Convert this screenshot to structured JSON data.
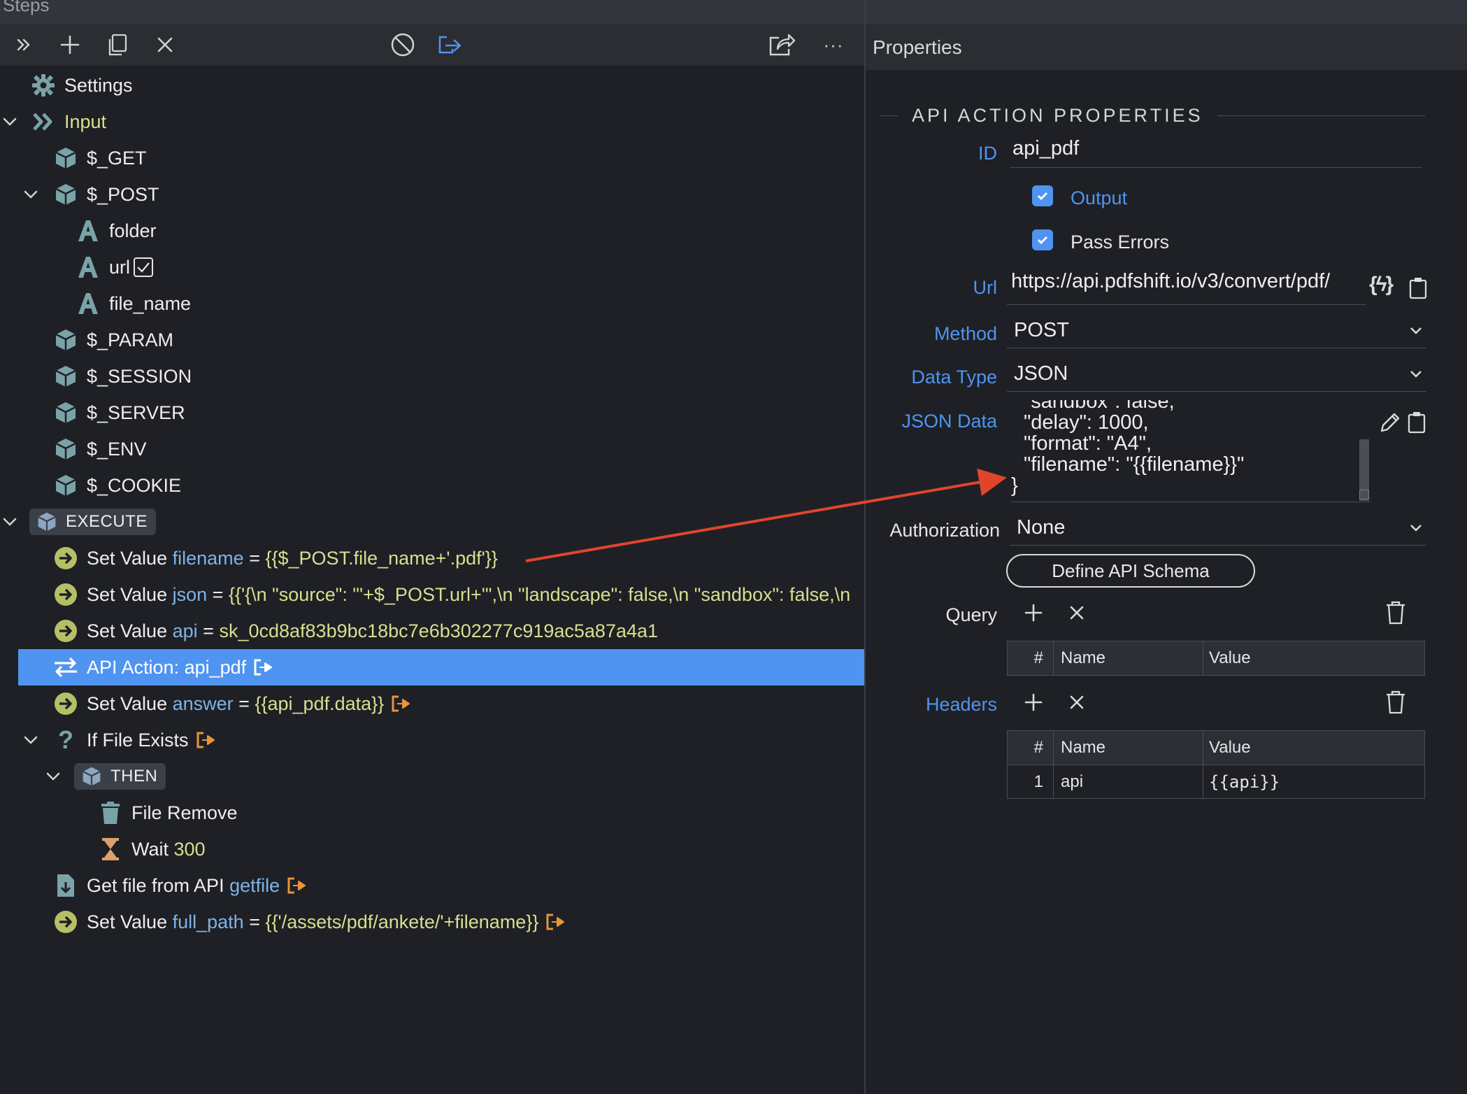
{
  "steps_panel": {
    "title": "Steps",
    "toolbar": {
      "expand_icon": "double-chevron-right-icon",
      "add_icon": "plus-icon",
      "copy_icon": "copy-icon",
      "remove_icon": "close-icon",
      "disable_icon": "ban-icon",
      "goto_icon": "goto-arrow-icon",
      "share_icon": "share-icon",
      "more": "···"
    },
    "tree": {
      "settings": "Settings",
      "input": "Input",
      "get": "$_GET",
      "post": "$_POST",
      "folder": "folder",
      "url": "url",
      "file_name": "file_name",
      "param": "$_PARAM",
      "session": "$_SESSION",
      "server": "$_SERVER",
      "env": "$_ENV",
      "cookie": "$_COOKIE",
      "execute": "EXECUTE",
      "set_value_kw": "Set Value",
      "sv1_var": "filename",
      "sv1_expr": "{{$_POST.file_name+'.pdf'}}",
      "sv2_var": "json",
      "sv2_expr": "{{'{\\n \"source\": \"'+$_POST.url+'\",\\n \"landscape\": false,\\n \"sandbox\": false,\\n",
      "sv3_var": "api",
      "sv3_expr": "sk_0cd8af83b9bc18bc7e6b302277c919ac5a87a4a1",
      "api_action": "API Action: api_pdf",
      "sv4_var": "answer",
      "sv4_expr": "{{api_pdf.data}}",
      "if_file_exists": "If File Exists",
      "then": "THEN",
      "file_remove": "File Remove",
      "wait_kw": "Wait",
      "wait_val": "300",
      "get_file": "Get file from API",
      "get_file_var": "getfile",
      "sv5_var": "full_path",
      "sv5_expr": "{{'/assets/pdf/ankete/'+filename}}",
      "equals": "="
    }
  },
  "properties_panel": {
    "title": "Properties",
    "section": "API ACTION PROPERTIES",
    "id_label": "ID",
    "id_value": "api_pdf",
    "output_label": "Output",
    "output_checked": true,
    "pass_errors_label": "Pass Errors",
    "pass_errors_checked": true,
    "url_label": "Url",
    "url_value": "https://api.pdfshift.io/v3/convert/pdf/",
    "url_dyn": "{ϟ}",
    "method_label": "Method",
    "method_value": "POST",
    "data_type_label": "Data Type",
    "data_type_value": "JSON",
    "json_data_label": "JSON Data",
    "json_lines": [
      "\"sandbox\": false,",
      "\"delay\": 1000,",
      "\"format\": \"A4\",",
      "\"filename\": \"{{filename}}\"",
      "}"
    ],
    "authorization_label": "Authorization",
    "authorization_value": "None",
    "define_schema": "Define API Schema",
    "query_label": "Query",
    "headers_label": "Headers",
    "grid_cols": [
      "#",
      "Name",
      "Value"
    ],
    "headers_rows": [
      {
        "n": "1",
        "name": "api",
        "value": "{{api}}"
      }
    ]
  },
  "colors": {
    "accent": "#4f94f0",
    "expression": "#d9df8e",
    "variable": "#7fb3e6",
    "exit_icon": "#e8943a",
    "arrow": "#e0452b",
    "icon_teal": "#7aa3a8",
    "icon_olive": "#b6bf66"
  }
}
